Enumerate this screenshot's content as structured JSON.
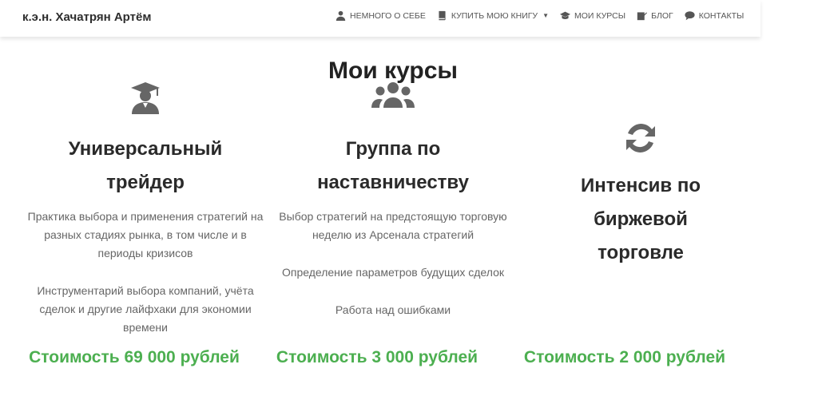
{
  "header": {
    "brand": "к.э.н. Хачатрян Артём",
    "nav": [
      {
        "label": "Немного о себе",
        "icon": "user-icon"
      },
      {
        "label": "Купить мою книгу",
        "icon": "book-icon",
        "dropdown": true
      },
      {
        "label": "Мои курсы",
        "icon": "graduation-cap-icon"
      },
      {
        "label": "Блог",
        "icon": "edit-icon"
      },
      {
        "label": "Контакты",
        "icon": "chat-icon"
      }
    ]
  },
  "main": {
    "title": "Мои курсы",
    "courses": [
      {
        "icon": "graduate-icon",
        "title_line1": "Универсальный",
        "title_line2": "трейдер",
        "description": [
          "Практика выбора и применения стратегий на разных стадиях рынка, в том числе и в периоды кризисов",
          "Инструментарий выбора компаний, учёта сделок и другие лайфхаки для экономии времени"
        ],
        "price": "Стоимость 69 000 рублей"
      },
      {
        "icon": "users-icon",
        "title_line1": "Группа по",
        "title_line2": "наставничеству",
        "description": [
          "Выбор стратегий на предстоящую торговую неделю из Арсенала стратегий",
          "Определение параметров будущих сделок",
          "Работа над ошибками"
        ],
        "price": "Стоимость 3 000 рублей"
      },
      {
        "icon": "sync-icon",
        "title_line1": "Интенсив по",
        "title_line2": "биржевой",
        "title_line3": "торговле",
        "description": [],
        "price": "Стоимость 2 000 рублей"
      }
    ]
  },
  "colors": {
    "price": "#4caf50",
    "icon": "#666666",
    "title": "#2a2a2a"
  }
}
